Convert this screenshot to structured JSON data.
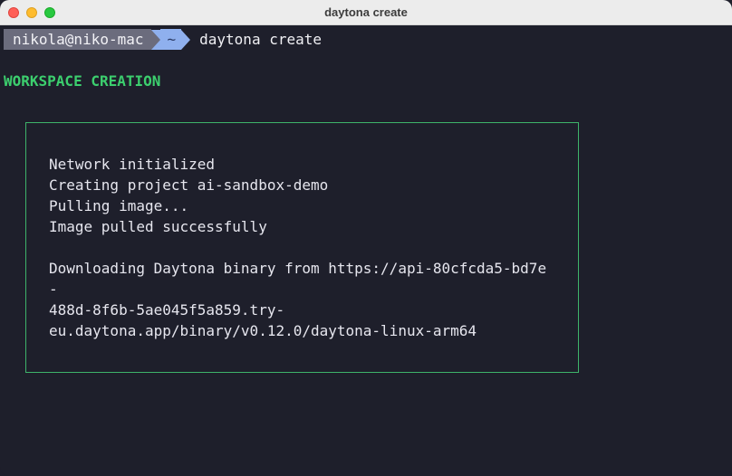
{
  "window": {
    "title": "daytona create"
  },
  "prompt": {
    "user_host": "nikola@niko-mac",
    "path": "~",
    "command": "daytona create"
  },
  "output": {
    "heading": "WORKSPACE CREATION",
    "lines": [
      "Network initialized",
      "Creating project ai-sandbox-demo",
      "Pulling image...",
      "Image pulled successfully",
      "Downloading Daytona binary from https://api-80cfcda5-bd7e",
      "-",
      "488d-8f6b-5ae045f5a859.try-",
      "eu.daytona.app/binary/v0.12.0/daytona-linux-arm64"
    ]
  },
  "colors": {
    "background": "#1e1f2b",
    "heading": "#3ccf6e",
    "box_border": "#3eb36a",
    "prompt_user_bg": "#6b6c7d",
    "prompt_path_bg": "#8fb0ee"
  }
}
